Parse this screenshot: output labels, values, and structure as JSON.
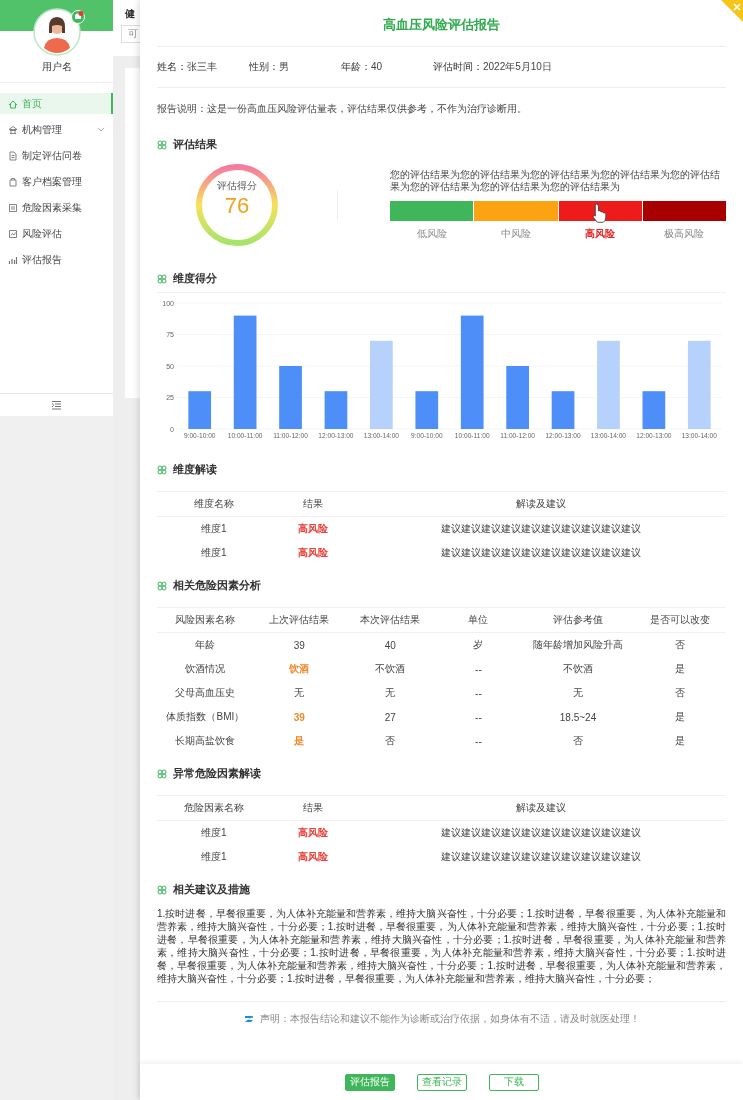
{
  "background": {
    "header_text": "健",
    "field_text": "可"
  },
  "sidebar": {
    "user_name": "用户名",
    "notification": true,
    "items": [
      {
        "label": "首页",
        "kind": "link",
        "selected": true
      },
      {
        "label": "机构管理",
        "kind": "group",
        "selected": false,
        "expanded": false
      },
      {
        "label": "制定评估问卷",
        "kind": "link",
        "selected": false
      },
      {
        "label": "客户档案管理",
        "kind": "link",
        "selected": false
      },
      {
        "label": "危险因素采集",
        "kind": "link",
        "selected": false
      },
      {
        "label": "风险评估",
        "kind": "link",
        "selected": false
      },
      {
        "label": "评估报告",
        "kind": "link",
        "selected": false
      }
    ]
  },
  "report": {
    "title": "高血压风险评估报告",
    "info": [
      {
        "label": "姓名：",
        "value": "张三丰"
      },
      {
        "label": "性别：",
        "value": "男"
      },
      {
        "label": "年龄：",
        "value": "40"
      },
      {
        "label": "评估时间：",
        "value": "2022年5月10日"
      }
    ],
    "note": "报告说明：这是一份高血压风险评估量表，评估结果仅供参考，不作为治疗诊断用。",
    "result": {
      "heading": "评估结果",
      "score_label": "评估得分",
      "score": "76",
      "text": "您的评估结果为您的评估结果为您的评估结果为您的评估结果为您的评估结果为您的评估结果为您的评估结果为您的评估结果为",
      "levels": [
        {
          "label": "低风险",
          "color": "#3fb65a",
          "selected": false
        },
        {
          "label": "中风险",
          "color": "#fba312",
          "selected": false
        },
        {
          "label": "高风险",
          "color": "#ee1b1b",
          "selected": true
        },
        {
          "label": "极高风险",
          "color": "#a80000",
          "selected": false
        }
      ]
    },
    "dimension_scores": {
      "heading": "维度得分",
      "chart_data": {
        "type": "bar",
        "categories": [
          "9:00-10:00",
          "10:00-11:00",
          "11:00-12:00",
          "12:00-13:00",
          "13:00-14:00",
          "9:00-10:00",
          "10:00-11:00",
          "11:00-12:00",
          "12:00-13:00",
          "13:00-14:00",
          "12:00-13:00",
          "13:00-14:00"
        ],
        "series": [
          {
            "color": "#4d8ef8",
            "values": [
              30,
              90,
              50,
              30,
              null,
              30,
              90,
              50,
              30,
              null,
              30,
              null
            ]
          },
          {
            "color": "#b6d1fb",
            "values": [
              null,
              null,
              null,
              null,
              70,
              null,
              null,
              null,
              null,
              70,
              null,
              70
            ]
          }
        ],
        "ylim": [
          0,
          100
        ],
        "yticks": [
          0,
          25,
          50,
          75,
          100
        ]
      }
    },
    "dimension_table": {
      "heading": "维度解读",
      "columns": [
        "维度名称",
        "结果",
        "解读及建议"
      ],
      "rows": [
        {
          "cells": [
            {
              "text": "维度1"
            },
            {
              "text": "高风险",
              "color": "#e8403a"
            },
            {
              "text": "建议建议建议建议建议建议建议建议建议建议"
            }
          ]
        },
        {
          "cells": [
            {
              "text": "维度1"
            },
            {
              "text": "高风险",
              "color": "#e8403a"
            },
            {
              "text": "建议建议建议建议建议建议建议建议建议建议"
            }
          ]
        }
      ]
    },
    "factor_table": {
      "heading": "相关危险因素分析",
      "columns": [
        "风险因素名称",
        "上次评估结果",
        "本次评估结果",
        "单位",
        "评估参考值",
        "是否可以改变"
      ],
      "rows": [
        {
          "cells": [
            {
              "text": "年龄"
            },
            {
              "text": "39"
            },
            {
              "text": "40"
            },
            {
              "text": "岁"
            },
            {
              "text": "随年龄增加风险升高"
            },
            {
              "text": "否"
            }
          ]
        },
        {
          "cells": [
            {
              "text": "饮酒情况"
            },
            {
              "text": "饮酒",
              "color": "#f08a2c"
            },
            {
              "text": "不饮酒"
            },
            {
              "text": "--"
            },
            {
              "text": "不饮酒"
            },
            {
              "text": "是"
            }
          ]
        },
        {
          "cells": [
            {
              "text": "父母高血压史"
            },
            {
              "text": "无"
            },
            {
              "text": "无"
            },
            {
              "text": "--"
            },
            {
              "text": "无"
            },
            {
              "text": "否"
            }
          ]
        },
        {
          "cells": [
            {
              "text": "体质指数（BMI）"
            },
            {
              "text": "39",
              "color": "#f08a2c"
            },
            {
              "text": "27"
            },
            {
              "text": "--"
            },
            {
              "text": "18.5~24"
            },
            {
              "text": "是"
            }
          ]
        },
        {
          "cells": [
            {
              "text": "长期高盐饮食"
            },
            {
              "text": "是",
              "color": "#f08a2c"
            },
            {
              "text": "否"
            },
            {
              "text": "--"
            },
            {
              "text": "否"
            },
            {
              "text": "是"
            }
          ]
        }
      ]
    },
    "abnormal_table": {
      "heading": "异常危险因素解读",
      "columns": [
        "危险因素名称",
        "结果",
        "解读及建议"
      ],
      "rows": [
        {
          "cells": [
            {
              "text": "维度1"
            },
            {
              "text": "高风险",
              "color": "#e8403a"
            },
            {
              "text": "建议建议建议建议建议建议建议建议建议建议"
            }
          ]
        },
        {
          "cells": [
            {
              "text": "维度1"
            },
            {
              "text": "高风险",
              "color": "#e8403a"
            },
            {
              "text": "建议建议建议建议建议建议建议建议建议建议"
            }
          ]
        }
      ]
    },
    "advice": {
      "heading": "相关建议及措施",
      "text": "1.按时进餐，早餐很重要，为人体补充能量和营养素，维持大脑兴奋性，十分必要；1.按时进餐，早餐很重要，为人体补充能量和营养素，维持大脑兴奋性，十分必要；1.按时进餐，早餐很重要，为人体补充能量和营养素，维持大脑兴奋性，十分必要；1.按时进餐，早餐很重要，为人体补充能量和营养素，维持大脑兴奋性，十分必要；1.按时进餐，早餐很重要，为人体补充能量和营养素，维持大脑兴奋性，十分必要；1.按时进餐，早餐很重要，为人体补充能量和营养素，维持大脑兴奋性，十分必要；1.按时进餐，早餐很重要，为人体补充能量和营养素，维持大脑兴奋性，十分必要；1.按时进餐，早餐很重要，为人体补充能量和营养素，维持大脑兴奋性，十分必要；1.按时进餐，早餐很重要，为人体补充能量和营养素，维持大脑兴奋性，十分必要；"
    },
    "disclaimer": "声明：本报告结论和建议不能作为诊断或治疗依据，如身体有不适，请及时就医处理！"
  },
  "buttons": [
    {
      "label": "评估报告",
      "primary": true
    },
    {
      "label": "查看记录",
      "primary": false
    },
    {
      "label": "下载",
      "primary": false
    }
  ]
}
